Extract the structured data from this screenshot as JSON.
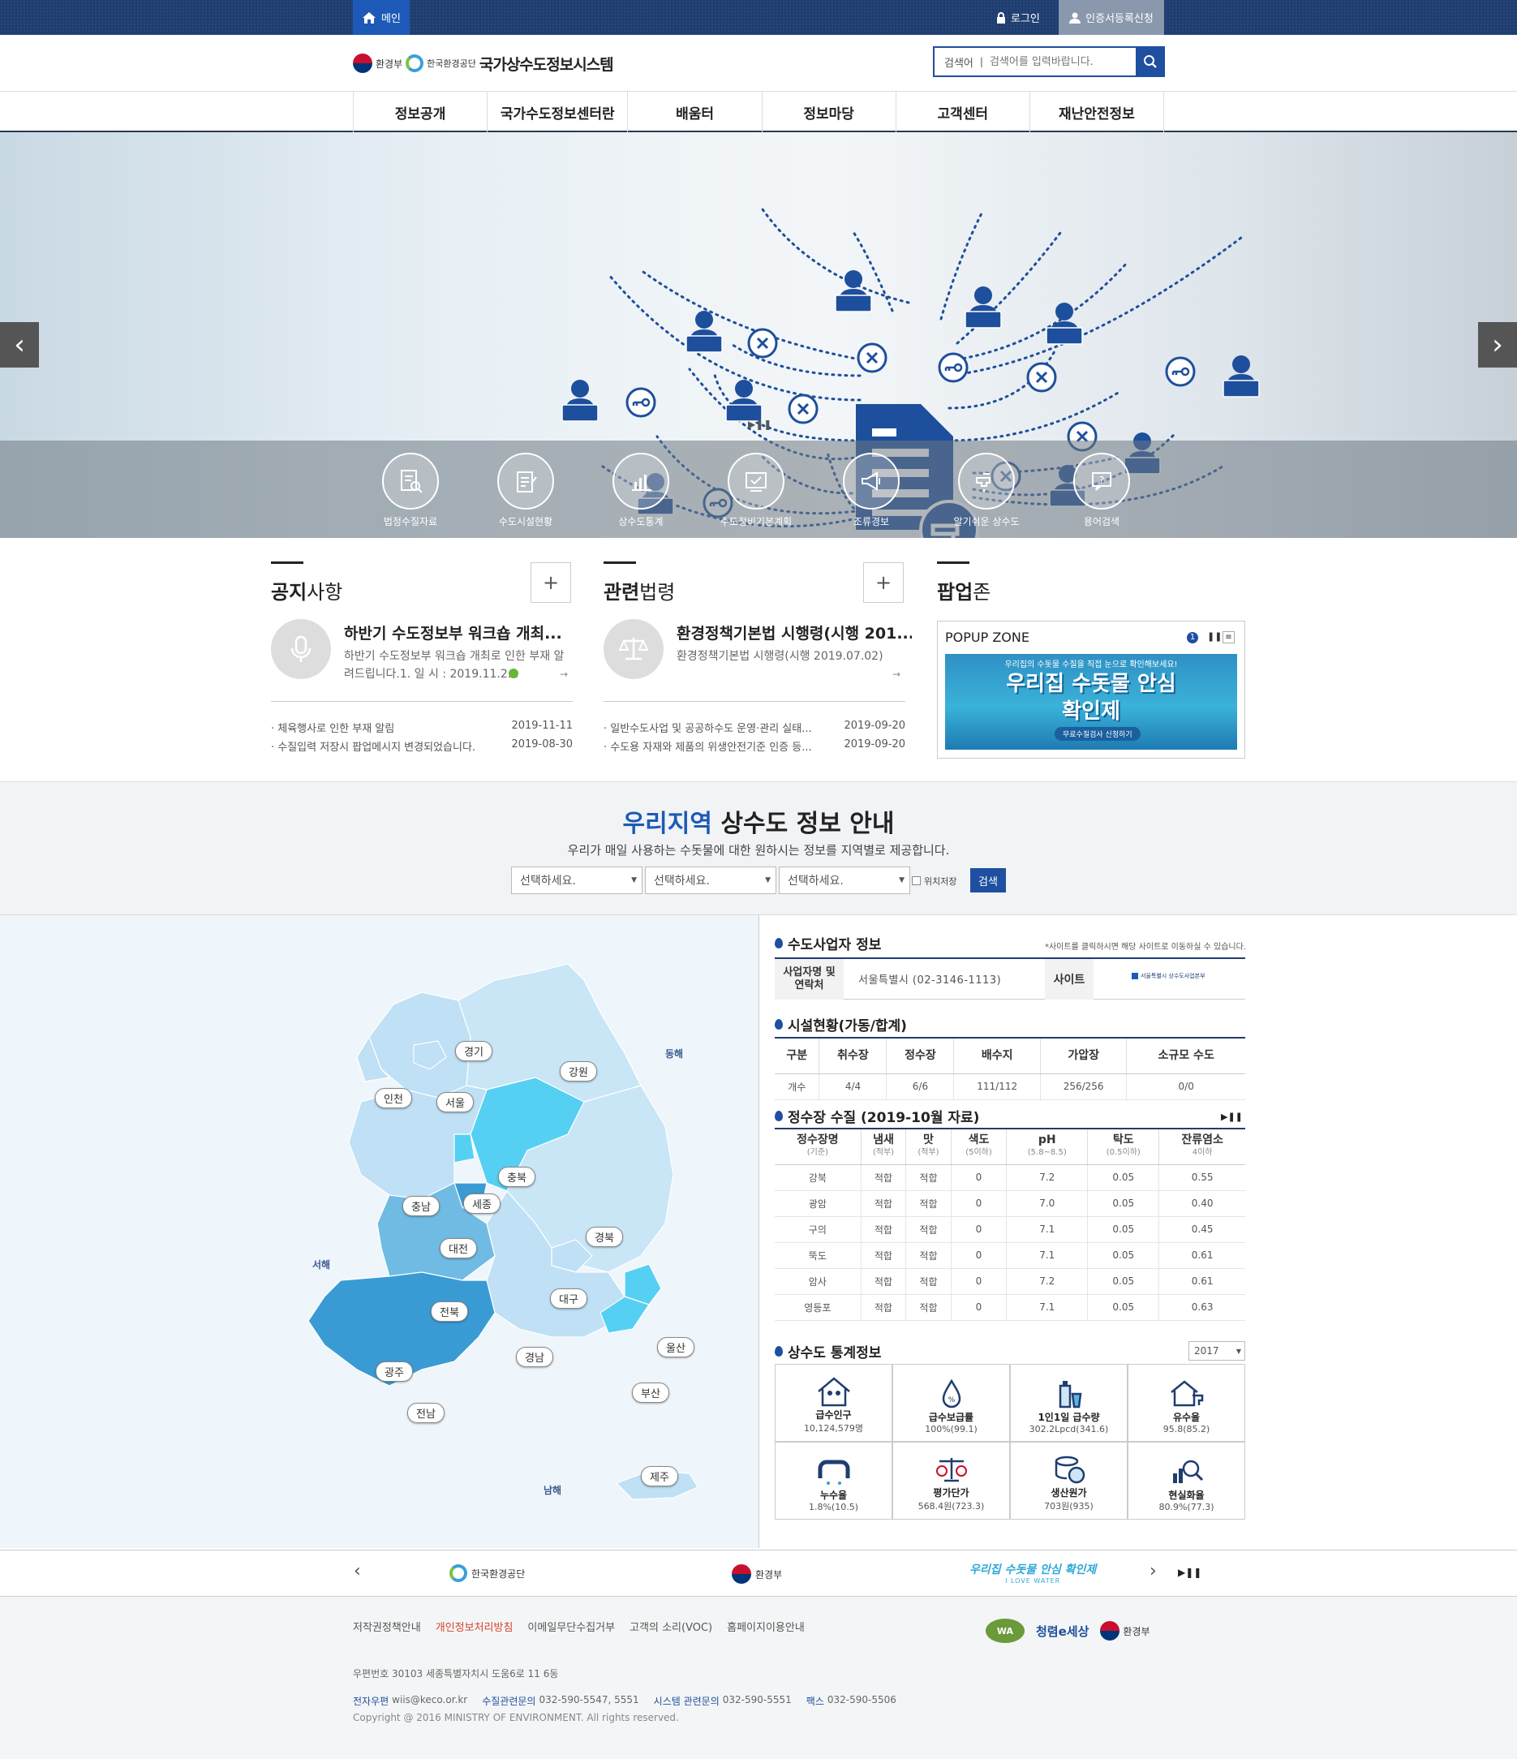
{
  "topbar": {
    "home": "메인",
    "login": "로그인",
    "cert": "인증서등록신청"
  },
  "header": {
    "ministry": "환경부",
    "agency": "한국환경공단",
    "site_title": "국가상수도정보시스템",
    "search_label": "검색어",
    "search_placeholder": "검색어를 입력바랍니다."
  },
  "nav": [
    "정보공개",
    "국가수도정보센터란",
    "배움터",
    "정보마당",
    "고객센터",
    "재난안전정보"
  ],
  "quick_links": [
    {
      "label": "법정수질자료",
      "icon": "document-search-icon"
    },
    {
      "label": "수도시설현황",
      "icon": "clipboard-edit-icon"
    },
    {
      "label": "상수도통계",
      "icon": "bar-chart-icon"
    },
    {
      "label": "수도정비기본계획",
      "icon": "plan-check-icon"
    },
    {
      "label": "조류경보",
      "icon": "megaphone-icon"
    },
    {
      "label": "알기쉬운 상수도",
      "icon": "faucet-icon"
    },
    {
      "label": "용어검색",
      "icon": "question-search-icon"
    }
  ],
  "notice": {
    "title_bold": "공지",
    "title_rest": "사항",
    "feature_title": "하반기 수도정보부 워크숍 개최...",
    "feature_desc": "하반기 수도정보부 워크숍 개최로 인한 부재 알려드립니다.1. 일 시 : 2019.11.2...",
    "items": [
      {
        "text": "· 체육행사로 인한 부재 알림",
        "date": "2019-11-11"
      },
      {
        "text": "· 수질입력 저장시 팝업메시지 변경되었습니다.",
        "date": "2019-08-30"
      }
    ]
  },
  "law": {
    "title_bold": "관련",
    "title_rest": "법령",
    "feature_title": "환경정책기본법 시행령(시행 201...",
    "feature_desc": "환경정책기본법 시행령(시행 2019.07.02)",
    "items": [
      {
        "text": "· 일반수도사업 및 공공하수도 운영·관리 실태...",
        "date": "2019-09-20"
      },
      {
        "text": "· 수도용 자재와 제품의 위생안전기준 인증 등...",
        "date": "2019-09-20"
      }
    ]
  },
  "popup": {
    "title_bold": "팝업",
    "title_rest": "존",
    "zone_label": "POPUP ZONE",
    "page": "1",
    "banner_top": "우리집의 수돗물 수질을 직접 눈으로 확인해보세요!",
    "banner_main": "우리집 수돗물 안심 확인제",
    "banner_btn": "무료수질검사 신청하기"
  },
  "region": {
    "title_blue": "우리지역",
    "title_rest": " 상수도 정보 안내",
    "subtitle": "우리가 매일 사용하는 수돗물에 대한 원하시는 정보를 지역별로 제공합니다.",
    "selects": [
      "선택하세요.",
      "선택하세요.",
      "선택하세요."
    ],
    "save_label": "위치저장",
    "search_btn": "검색"
  },
  "map": {
    "regions": [
      "경기",
      "강원",
      "인천",
      "서울",
      "충북",
      "충남",
      "세종",
      "경북",
      "대전",
      "전북",
      "대구",
      "광주",
      "경남",
      "울산",
      "부산",
      "전남",
      "제주"
    ],
    "seas": {
      "east": "동해",
      "west": "서해",
      "south": "남해"
    }
  },
  "provider": {
    "title": "수도사업자 정보",
    "note": "*사이트를 클릭하시면 해당 사이트로 이동하실 수 있습니다.",
    "name_label": "사업자명 및 연락처",
    "name_value": "서울특별시 (02-3146-1113)",
    "site_label": "사이트",
    "site_logo": "서울특별시 상수도사업본부"
  },
  "facility": {
    "title": "시설현황(가동/합계)",
    "headers": [
      "구분",
      "취수장",
      "정수장",
      "배수지",
      "가압장",
      "소규모 수도"
    ],
    "row": [
      "개수",
      "4/4",
      "6/6",
      "111/112",
      "256/256",
      "0/0"
    ]
  },
  "quality": {
    "title": "정수장 수질 (2019-10월 자료)",
    "headers": [
      {
        "name": "정수장명",
        "sub": "(기준)"
      },
      {
        "name": "냄새",
        "sub": "(적부)"
      },
      {
        "name": "맛",
        "sub": "(적부)"
      },
      {
        "name": "색도",
        "sub": "(5이하)"
      },
      {
        "name": "pH",
        "sub": "(5.8~8.5)"
      },
      {
        "name": "탁도",
        "sub": "(0.5이하)"
      },
      {
        "name": "잔류염소",
        "sub": "4이하"
      }
    ],
    "rows": [
      [
        "강북",
        "적합",
        "적합",
        "0",
        "7.2",
        "0.05",
        "0.55"
      ],
      [
        "광암",
        "적합",
        "적합",
        "0",
        "7.0",
        "0.05",
        "0.40"
      ],
      [
        "구의",
        "적합",
        "적합",
        "0",
        "7.1",
        "0.05",
        "0.45"
      ],
      [
        "뚝도",
        "적합",
        "적합",
        "0",
        "7.1",
        "0.05",
        "0.61"
      ],
      [
        "암사",
        "적합",
        "적합",
        "0",
        "7.2",
        "0.05",
        "0.61"
      ],
      [
        "영등포",
        "적합",
        "적합",
        "0",
        "7.1",
        "0.05",
        "0.63"
      ]
    ]
  },
  "stats": {
    "title": "상수도 통계정보",
    "year": "2017",
    "items": [
      {
        "name": "급수인구",
        "value": "10,124,579명",
        "icon": "house-people-icon"
      },
      {
        "name": "급수보급률",
        "value": "100%(99.1)",
        "icon": "water-drop-percent-icon"
      },
      {
        "name": "1인1일 급수량",
        "value": "302.2Lpcd(341.6)",
        "icon": "bottle-cup-icon"
      },
      {
        "name": "유수율",
        "value": "95.8(85.2)",
        "icon": "house-faucet-icon"
      },
      {
        "name": "누수율",
        "value": "1.8%(10.5)",
        "icon": "leaking-pipe-icon"
      },
      {
        "name": "평가단가",
        "value": "568.4원(723.3)",
        "icon": "scale-won-icon"
      },
      {
        "name": "생산원가",
        "value": "703원(935)",
        "icon": "coins-won-icon"
      },
      {
        "name": "현실화율",
        "value": "80.9%(77.3)",
        "icon": "chart-magnifier-icon"
      }
    ]
  },
  "partners": {
    "items": [
      "한국환경공단",
      "환경부",
      "우리집 수돗물 안심 확인제"
    ],
    "sub": "I LOVE WATER"
  },
  "footer": {
    "links": [
      "저작권정책안내",
      "개인정보처리방침",
      "이메일무단수집거부",
      "고객의 소리(VOC)",
      "홈페이지이용안내"
    ],
    "address": "우편번호 30103 세종특별자치시 도움6로 11 6동",
    "email_label": "전자우편",
    "email": "wiis@keco.or.kr",
    "water_label": "수질관련문의",
    "water_tel": "032-590-5547, 5551",
    "sys_label": "시스템 관련문의",
    "sys_tel": "032-590-5551",
    "fax_label": "팩스",
    "fax": "032-590-5506",
    "copyright": "Copyright @ 2016 MINISTRY OF ENVIRONMENT. All rights reserved.",
    "logos": [
      "WA",
      "청렴e세상",
      "환경부"
    ]
  },
  "colors": {
    "primary": "#1f4fa0",
    "navy": "#1f3d6f",
    "accent_red": "#c8102e",
    "map_light": "#bfe0f5",
    "map_mid": "#6fbbe3",
    "map_dark": "#3a9bd4",
    "map_hl": "#55d0f2"
  }
}
